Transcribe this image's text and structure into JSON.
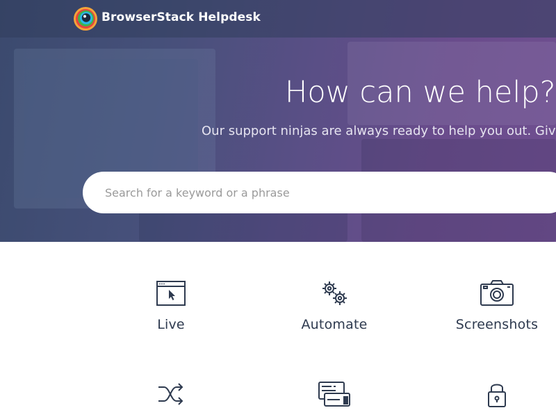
{
  "header": {
    "brand": "BrowserStack Helpdesk",
    "logo_icon": "browserstack-logo-icon"
  },
  "hero": {
    "title": "How can we help?",
    "subtitle": "Our support ninjas are always ready to help you out. Give"
  },
  "search": {
    "placeholder": "Search for a keyword or a phrase",
    "value": ""
  },
  "categories": [
    {
      "label": "Live",
      "icon": "browser-window-cursor-icon"
    },
    {
      "label": "Automate",
      "icon": "gears-icon"
    },
    {
      "label": "Screenshots",
      "icon": "camera-icon"
    },
    {
      "label": "",
      "icon": "shuffle-icon"
    },
    {
      "label": "",
      "icon": "billing-card-icon"
    },
    {
      "label": "",
      "icon": "lock-icon"
    }
  ],
  "colors": {
    "hero_start": "#3b4a6e",
    "hero_end": "#6f4f90",
    "text_dark": "#2e3a4f",
    "white": "#ffffff"
  }
}
